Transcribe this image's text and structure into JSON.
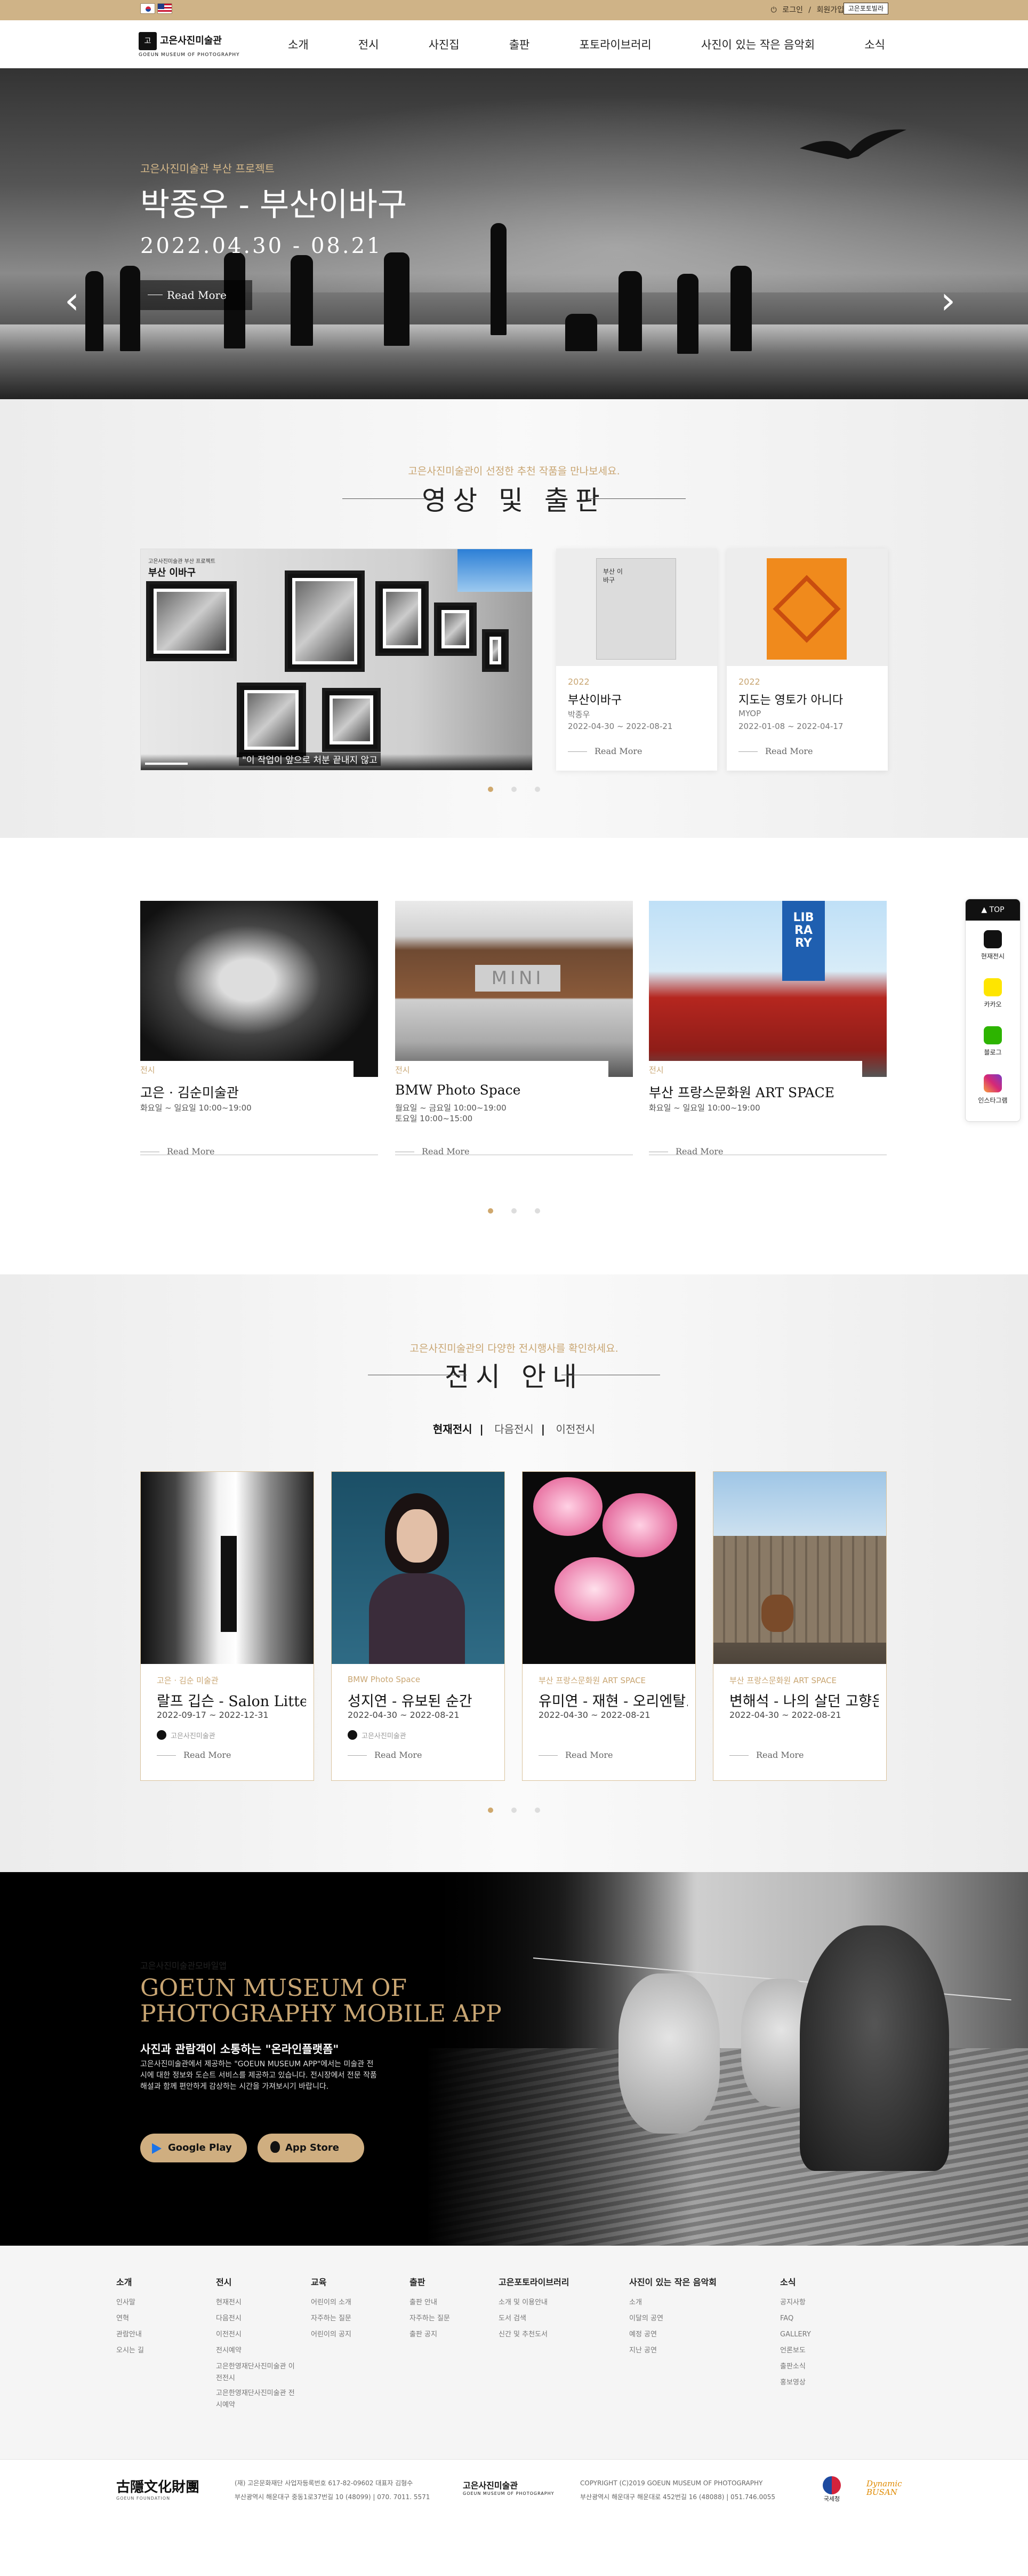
{
  "lang": {
    "kr": "KR",
    "en": "EN"
  },
  "toplinks": {
    "login": "로그인",
    "sep": "/",
    "join": "회원가입",
    "badge": "고은포토빌라"
  },
  "logo": {
    "mark": "고",
    "ko": "고은사진미술관",
    "en": "GOEUN MUSEUM OF PHOTOGRAPHY"
  },
  "menu": [
    "소개",
    "전시",
    "사진집",
    "출판",
    "포토라이브러리",
    "사진이 있는 작은 음악회",
    "소식"
  ],
  "hero": {
    "sub": "고은사진미술관 부산 프로젝트",
    "title": "박종우 - 부산이바구",
    "date": "2022.04.30 - 08.21",
    "button": "Read More",
    "prev": "‹",
    "next": "›"
  },
  "media": {
    "kicker": "고은사진미술관이 선정한 추천 작품을 만나보세요.",
    "title": "영상 및 출판",
    "video": {
      "t1": "고은사진미술관 부산 프로젝트",
      "t2": "부산 이바구",
      "caption": "\"이 작업이 앞으로 처분 끝내지 않고"
    },
    "books": [
      {
        "year": "2022",
        "title": "부산이바구",
        "author": "박종우",
        "date": "2022-04-30 ~ 2022-08-21",
        "more": "Read More",
        "cover_text": "부산 이바구"
      },
      {
        "year": "2022",
        "title": "지도는 영토가 아니다",
        "author": "MYOP",
        "date": "2022-01-08 ~ 2022-04-17",
        "more": "Read More",
        "cover_text": ""
      }
    ]
  },
  "places": [
    {
      "cat": "전시",
      "name": "고은 · 김순미술관",
      "hours": "화요일 ~ 일요일 10:00~19:00",
      "more": "Read More"
    },
    {
      "cat": "전시",
      "name": "BMW Photo Space",
      "hours": "월요일 ~ 금요일 10:00~19:00\n토요일 10:00~15:00",
      "more": "Read More"
    },
    {
      "cat": "전시",
      "name": "부산 프랑스문화원 ART SPACE",
      "hours": "화요일 ~ 일요일 10:00~19:00",
      "more": "Read More"
    }
  ],
  "exhibitions": {
    "kicker": "고은사진미술관의 다양한 전시행사를 확인하세요.",
    "title": "전시 안내",
    "tabs": [
      "현재전시",
      "다음전시",
      "이전전시"
    ],
    "tab_sep": "|",
    "cards": [
      {
        "place": "고은 · 김순 미술관",
        "name": "랄프 깁슨 - Salon Litte...",
        "date": "2022-09-17 ~ 2022-12-31",
        "author": "고은사진미술관",
        "more": "Read More"
      },
      {
        "place": "BMW Photo Space",
        "name": "성지연 - 유보된 순간",
        "date": "2022-04-30 ~ 2022-08-21",
        "author": "고은사진미술관",
        "more": "Read More"
      },
      {
        "place": "부산 프랑스문화원 ART SPACE",
        "name": "유미연 - 재현 - 오리엔탈...",
        "date": "2022-04-30 ~ 2022-08-21",
        "author": "",
        "more": "Read More"
      },
      {
        "place": "부산 프랑스문화원 ART SPACE",
        "name": "변해석 - 나의 살던 고향은",
        "date": "2022-04-30 ~ 2022-08-21",
        "author": "",
        "more": "Read More"
      }
    ]
  },
  "app": {
    "kicker": "고은사진미술관모바일앱",
    "title1": "GOEUN MUSEUM OF",
    "title2": "PHOTOGRAPHY MOBILE APP",
    "sub": "사진과 관람객이 소통하는 \"온라인플랫폼\"",
    "desc": "고은사진미술관에서 제공하는 \"GOEUN MUSEUM APP\"에서는 미술관 전시에 대한 정보와 도슨트 서비스를 제공하고 있습니다. 전시장에서 전문 작품 해설과 함께 편안하게 감상하는 시간을 가져보시기 바랍니다.",
    "google": "Google Play",
    "apple": "App Store"
  },
  "side": {
    "top": "▲ TOP",
    "items": [
      "현재전시",
      "카카오",
      "블로그",
      "인스타그램"
    ]
  },
  "footer": {
    "cols": [
      {
        "h": "소개",
        "items": [
          "인사말",
          "연혁",
          "관람안내",
          "오시는 길"
        ]
      },
      {
        "h": "전시",
        "items": [
          "현재전시",
          "다음전시",
          "이전전시",
          "전시예약",
          "고은한영재단사진미술관 이전전시",
          "고은한영재단사진미술관 전시예약"
        ]
      },
      {
        "h": "교육",
        "items": [
          "어린이의 소개",
          "자주하는 질문",
          "어린이의 공지"
        ]
      },
      {
        "h": "출판",
        "items": [
          "출판 안내",
          "자주하는 질문",
          "출판 공지"
        ]
      },
      {
        "h": "고은포토라이브러리",
        "items": [
          "소개 및 이용안내",
          "도서 검색",
          "신간 및 추천도서"
        ]
      },
      {
        "h": "사진이 있는 작은 음악회",
        "items": [
          "소개",
          "이달의 공연",
          "예정 공연",
          "지난 공연"
        ]
      },
      {
        "h": "소식",
        "items": [
          "공지사항",
          "FAQ",
          "GALLERY",
          "언론보도",
          "출판소식",
          "홍보영상"
        ]
      }
    ],
    "foundation": "古隱文化財團",
    "foundation_en": "GOEUN FOUNDATION",
    "f_addr1": "(재) 고은문화재단 사업자등록번호 617-82-09602 대표자 김형수",
    "f_addr2": "부산광역시 해운대구 중동1로37번길 10 (48099)  |  070. 7011. 5571",
    "museum_logo": "고은사진미술관",
    "museum_en": "GOEUN MUSEUM OF PHOTOGRAPHY",
    "copy1": "COPYRIGHT (C)2019 GOEUN MUSEUM OF PHOTOGRAPHY",
    "copy2": "부산광역시 해운대구 해운대로 452번길 16 (48088)  |  051.746.0055",
    "partner1": "국세청",
    "partner2": "Dynamic BUSAN"
  }
}
